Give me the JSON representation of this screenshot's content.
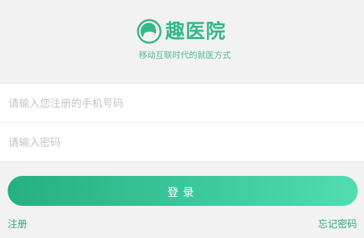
{
  "brand": {
    "name": "趣医院",
    "slogan": "移动互联时代的就医方式",
    "logo_icon": "head-silhouette-icon",
    "accent_color": "#34b987"
  },
  "form": {
    "phone": {
      "placeholder": "请输入您注册的手机号码",
      "value": ""
    },
    "password": {
      "placeholder": "请输入密码",
      "value": ""
    }
  },
  "actions": {
    "login_label": "登录",
    "register_label": "注册",
    "forgot_password_label": "忘记密码"
  },
  "colors": {
    "background": "#f2f2f2",
    "button_gradient_start": "#24b081",
    "button_gradient_end": "#50ddb0",
    "link": "#2fa979"
  }
}
